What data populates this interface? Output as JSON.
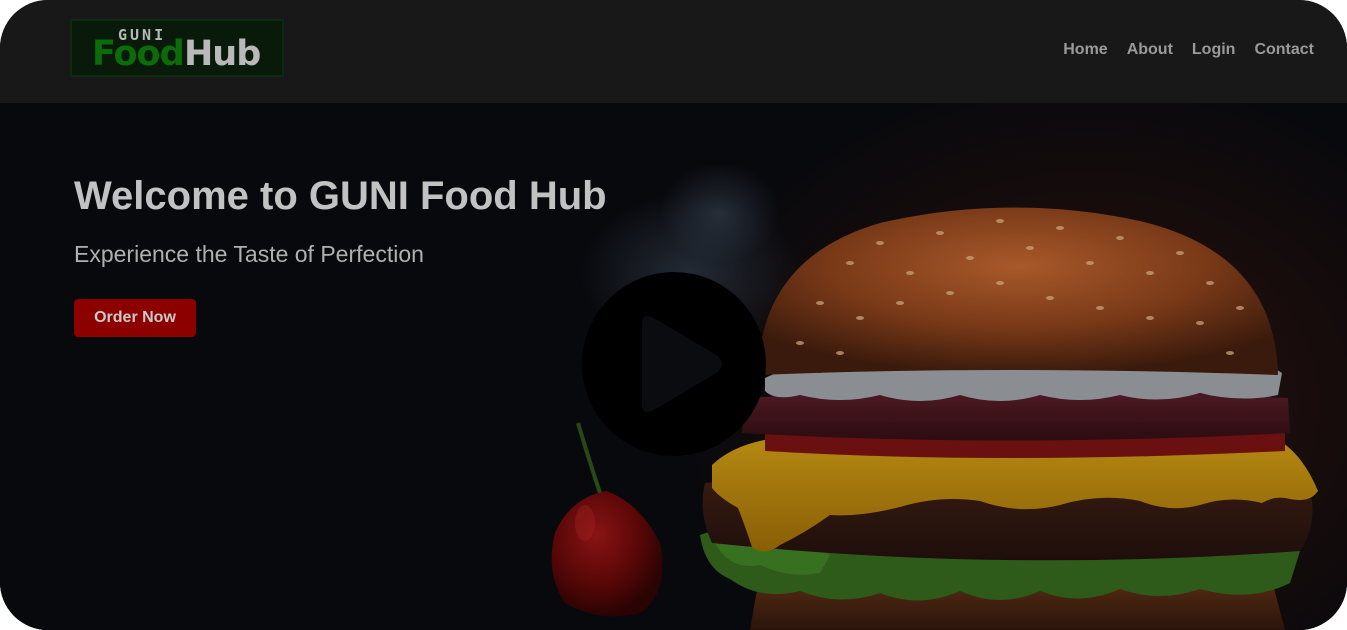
{
  "brand": {
    "logo_top": "GUNI",
    "logo_food": "Food",
    "logo_hub": "Hub"
  },
  "nav": {
    "items": [
      {
        "label": "Home"
      },
      {
        "label": "About"
      },
      {
        "label": "Login"
      },
      {
        "label": "Contact"
      }
    ]
  },
  "hero": {
    "title": "Welcome to GUNI Food Hub",
    "subtitle": "Experience the Taste of Perfection",
    "cta_label": "Order Now",
    "background_image": "burger-photo",
    "video_control": "play-icon"
  },
  "colors": {
    "header_bg": "#181818",
    "hero_bg": "#07090d",
    "cta_bg": "#8c0000",
    "logo_green": "#0a6d0a",
    "nav_text": "#9a9a9a"
  }
}
